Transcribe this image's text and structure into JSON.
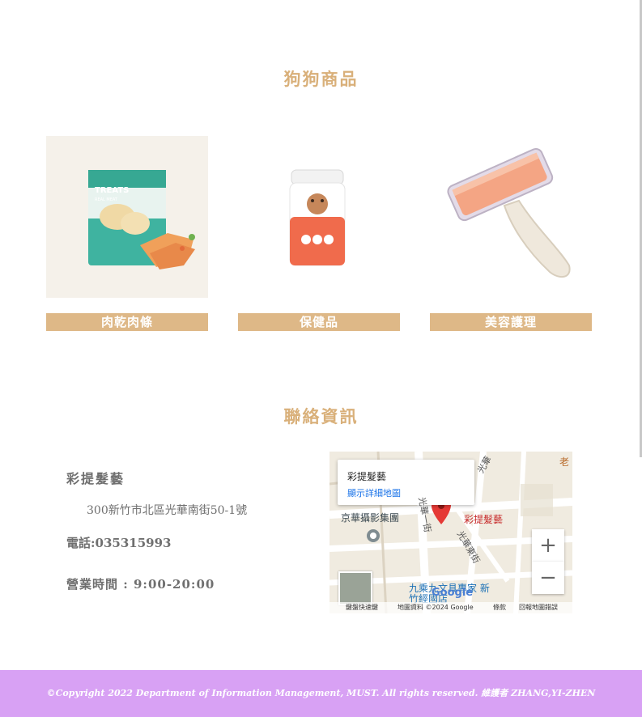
{
  "products": {
    "title": "狗狗商品",
    "items": [
      {
        "label": "肉乾肉條",
        "pack_title": "TREATS",
        "pack_subtitle": "REAL MEAT"
      },
      {
        "label": "保健品"
      },
      {
        "label": "美容護理"
      }
    ]
  },
  "contact": {
    "title": "聯絡資訊",
    "shop_name": "彩提髮藝",
    "address": "300新竹市北區光華南街50-1號",
    "phone": "電話:035315993",
    "hours": "營業時間 : 9:00-20:00"
  },
  "map": {
    "place_name": "彩提髮藝",
    "details_link": "顯示詳細地圖",
    "marker_label": "彩提髮藝",
    "label_studio": "京華攝影集團",
    "label_store": "九乘九文具專家 新竹經國店",
    "street_1": "光華東街",
    "street_2": "光華一街",
    "street_3": "光華",
    "corner_label": "老",
    "google_logo": "Google",
    "zoom_in": "+",
    "zoom_out": "−",
    "footer": {
      "shortcuts": "鍵盤快速鍵",
      "data": "地圖資料 ©2024 Google",
      "terms": "條款",
      "report": "回報地圖錯誤"
    }
  },
  "footer": {
    "copyright": "©Copyright 2022 Department of Information Management, MUST. All rights reserved. 維護者 ZHANG,YI-ZHEN"
  },
  "colors": {
    "accent": "#deb887",
    "title": "#d9b07a",
    "footer_bg": "#d8a1f4",
    "marker": "#e53935"
  }
}
